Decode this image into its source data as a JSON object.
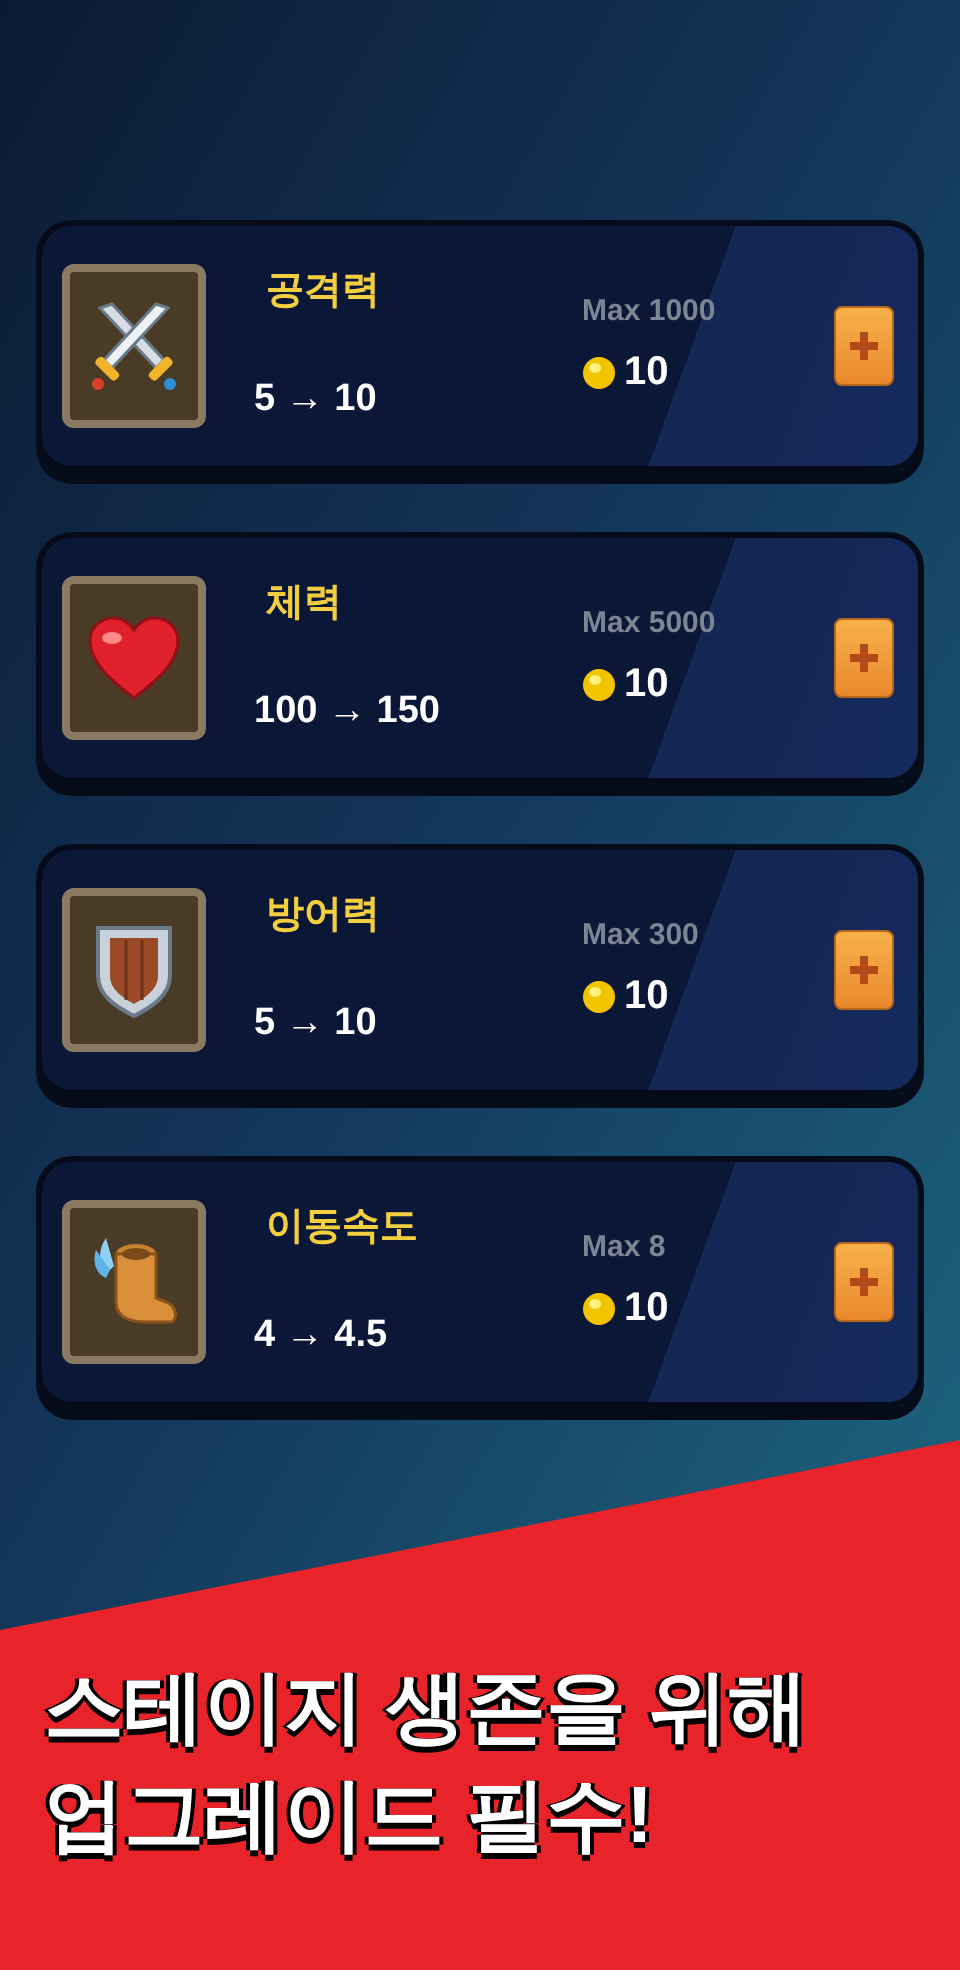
{
  "upgrades": [
    {
      "kind": "sword",
      "name": "공격력",
      "change": "5 → 10",
      "max": "Max 1000",
      "cost": "10"
    },
    {
      "kind": "heart",
      "name": "체력",
      "change": "100 → 150",
      "max": "Max 5000",
      "cost": "10"
    },
    {
      "kind": "shield",
      "name": "방어력",
      "change": "5 → 10",
      "max": "Max 300",
      "cost": "10"
    },
    {
      "kind": "boot",
      "name": "이동속도",
      "change": "4 → 4.5",
      "max": "Max 8",
      "cost": "10"
    }
  ],
  "banner": {
    "lines": [
      "스테이지 생존을 위해",
      "업그레이드 필수!"
    ]
  }
}
